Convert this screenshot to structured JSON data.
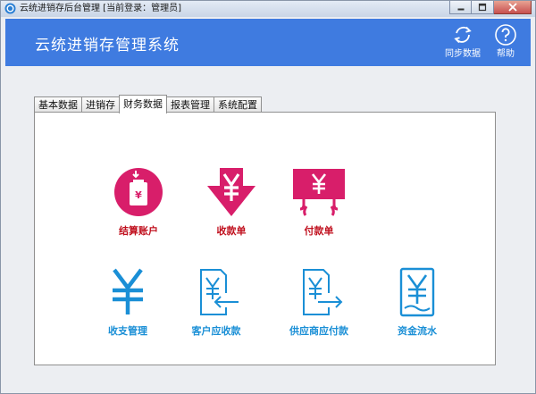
{
  "window": {
    "title": "云统进销存后台管理 [当前登录：管理员]"
  },
  "header": {
    "app_title": "云统进销存管理系统",
    "sync_label": "同步数据",
    "help_label": "帮助"
  },
  "tabs": [
    {
      "label": "基本数据",
      "active": false
    },
    {
      "label": "进销存",
      "active": false
    },
    {
      "label": "财务数据",
      "active": true
    },
    {
      "label": "报表管理",
      "active": false
    },
    {
      "label": "系统配置",
      "active": false
    }
  ],
  "finance": {
    "items": [
      {
        "label": "结算账户",
        "icon": "settlement-account-icon",
        "color": "#d81e6a"
      },
      {
        "label": "收款单",
        "icon": "receipt-icon",
        "color": "#d81e6a"
      },
      {
        "label": "付款单",
        "icon": "payment-icon",
        "color": "#d81e6a"
      },
      {
        "label": "收支管理",
        "icon": "yen-icon",
        "color": "#1a8fd6"
      },
      {
        "label": "客户应收款",
        "icon": "customer-receivable-icon",
        "color": "#1a8fd6"
      },
      {
        "label": "供应商应付款",
        "icon": "supplier-payable-icon",
        "color": "#1a8fd6"
      },
      {
        "label": "资金流水",
        "icon": "cash-flow-icon",
        "color": "#1a8fd6"
      }
    ]
  },
  "colors": {
    "header_bg": "#3f7be0",
    "pink": "#d81e6a",
    "pink_label": "#c0101e",
    "blue": "#1a8fd6"
  }
}
